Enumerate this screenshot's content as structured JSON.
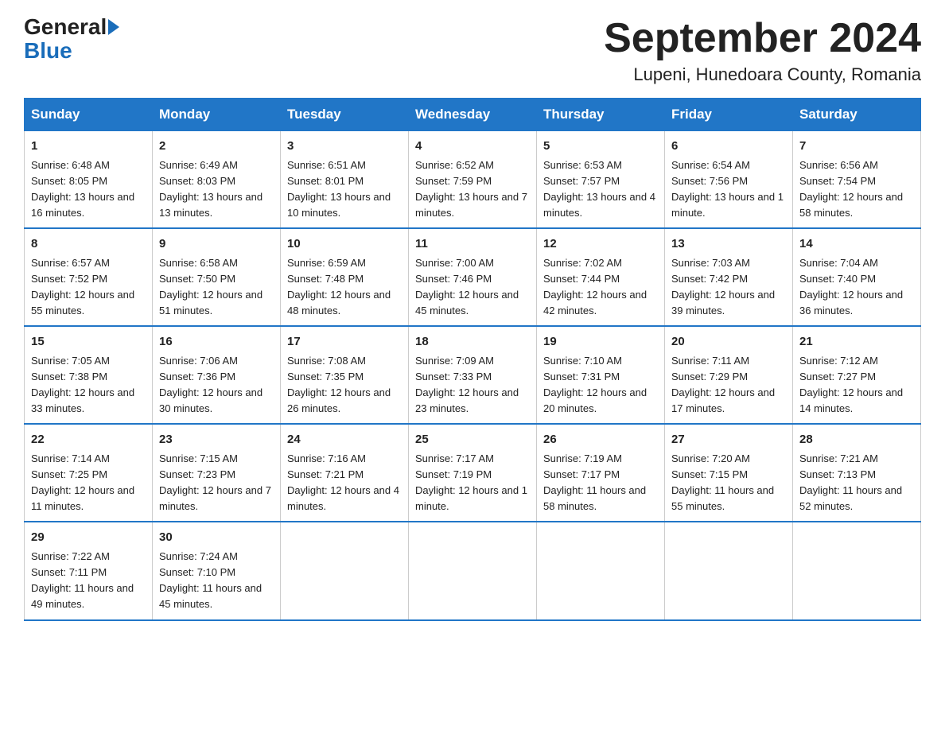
{
  "header": {
    "logo_general": "General",
    "logo_blue": "Blue",
    "month_title": "September 2024",
    "location": "Lupeni, Hunedoara County, Romania"
  },
  "days_of_week": [
    "Sunday",
    "Monday",
    "Tuesday",
    "Wednesday",
    "Thursday",
    "Friday",
    "Saturday"
  ],
  "weeks": [
    [
      {
        "day": "1",
        "sunrise": "Sunrise: 6:48 AM",
        "sunset": "Sunset: 8:05 PM",
        "daylight": "Daylight: 13 hours and 16 minutes."
      },
      {
        "day": "2",
        "sunrise": "Sunrise: 6:49 AM",
        "sunset": "Sunset: 8:03 PM",
        "daylight": "Daylight: 13 hours and 13 minutes."
      },
      {
        "day": "3",
        "sunrise": "Sunrise: 6:51 AM",
        "sunset": "Sunset: 8:01 PM",
        "daylight": "Daylight: 13 hours and 10 minutes."
      },
      {
        "day": "4",
        "sunrise": "Sunrise: 6:52 AM",
        "sunset": "Sunset: 7:59 PM",
        "daylight": "Daylight: 13 hours and 7 minutes."
      },
      {
        "day": "5",
        "sunrise": "Sunrise: 6:53 AM",
        "sunset": "Sunset: 7:57 PM",
        "daylight": "Daylight: 13 hours and 4 minutes."
      },
      {
        "day": "6",
        "sunrise": "Sunrise: 6:54 AM",
        "sunset": "Sunset: 7:56 PM",
        "daylight": "Daylight: 13 hours and 1 minute."
      },
      {
        "day": "7",
        "sunrise": "Sunrise: 6:56 AM",
        "sunset": "Sunset: 7:54 PM",
        "daylight": "Daylight: 12 hours and 58 minutes."
      }
    ],
    [
      {
        "day": "8",
        "sunrise": "Sunrise: 6:57 AM",
        "sunset": "Sunset: 7:52 PM",
        "daylight": "Daylight: 12 hours and 55 minutes."
      },
      {
        "day": "9",
        "sunrise": "Sunrise: 6:58 AM",
        "sunset": "Sunset: 7:50 PM",
        "daylight": "Daylight: 12 hours and 51 minutes."
      },
      {
        "day": "10",
        "sunrise": "Sunrise: 6:59 AM",
        "sunset": "Sunset: 7:48 PM",
        "daylight": "Daylight: 12 hours and 48 minutes."
      },
      {
        "day": "11",
        "sunrise": "Sunrise: 7:00 AM",
        "sunset": "Sunset: 7:46 PM",
        "daylight": "Daylight: 12 hours and 45 minutes."
      },
      {
        "day": "12",
        "sunrise": "Sunrise: 7:02 AM",
        "sunset": "Sunset: 7:44 PM",
        "daylight": "Daylight: 12 hours and 42 minutes."
      },
      {
        "day": "13",
        "sunrise": "Sunrise: 7:03 AM",
        "sunset": "Sunset: 7:42 PM",
        "daylight": "Daylight: 12 hours and 39 minutes."
      },
      {
        "day": "14",
        "sunrise": "Sunrise: 7:04 AM",
        "sunset": "Sunset: 7:40 PM",
        "daylight": "Daylight: 12 hours and 36 minutes."
      }
    ],
    [
      {
        "day": "15",
        "sunrise": "Sunrise: 7:05 AM",
        "sunset": "Sunset: 7:38 PM",
        "daylight": "Daylight: 12 hours and 33 minutes."
      },
      {
        "day": "16",
        "sunrise": "Sunrise: 7:06 AM",
        "sunset": "Sunset: 7:36 PM",
        "daylight": "Daylight: 12 hours and 30 minutes."
      },
      {
        "day": "17",
        "sunrise": "Sunrise: 7:08 AM",
        "sunset": "Sunset: 7:35 PM",
        "daylight": "Daylight: 12 hours and 26 minutes."
      },
      {
        "day": "18",
        "sunrise": "Sunrise: 7:09 AM",
        "sunset": "Sunset: 7:33 PM",
        "daylight": "Daylight: 12 hours and 23 minutes."
      },
      {
        "day": "19",
        "sunrise": "Sunrise: 7:10 AM",
        "sunset": "Sunset: 7:31 PM",
        "daylight": "Daylight: 12 hours and 20 minutes."
      },
      {
        "day": "20",
        "sunrise": "Sunrise: 7:11 AM",
        "sunset": "Sunset: 7:29 PM",
        "daylight": "Daylight: 12 hours and 17 minutes."
      },
      {
        "day": "21",
        "sunrise": "Sunrise: 7:12 AM",
        "sunset": "Sunset: 7:27 PM",
        "daylight": "Daylight: 12 hours and 14 minutes."
      }
    ],
    [
      {
        "day": "22",
        "sunrise": "Sunrise: 7:14 AM",
        "sunset": "Sunset: 7:25 PM",
        "daylight": "Daylight: 12 hours and 11 minutes."
      },
      {
        "day": "23",
        "sunrise": "Sunrise: 7:15 AM",
        "sunset": "Sunset: 7:23 PM",
        "daylight": "Daylight: 12 hours and 7 minutes."
      },
      {
        "day": "24",
        "sunrise": "Sunrise: 7:16 AM",
        "sunset": "Sunset: 7:21 PM",
        "daylight": "Daylight: 12 hours and 4 minutes."
      },
      {
        "day": "25",
        "sunrise": "Sunrise: 7:17 AM",
        "sunset": "Sunset: 7:19 PM",
        "daylight": "Daylight: 12 hours and 1 minute."
      },
      {
        "day": "26",
        "sunrise": "Sunrise: 7:19 AM",
        "sunset": "Sunset: 7:17 PM",
        "daylight": "Daylight: 11 hours and 58 minutes."
      },
      {
        "day": "27",
        "sunrise": "Sunrise: 7:20 AM",
        "sunset": "Sunset: 7:15 PM",
        "daylight": "Daylight: 11 hours and 55 minutes."
      },
      {
        "day": "28",
        "sunrise": "Sunrise: 7:21 AM",
        "sunset": "Sunset: 7:13 PM",
        "daylight": "Daylight: 11 hours and 52 minutes."
      }
    ],
    [
      {
        "day": "29",
        "sunrise": "Sunrise: 7:22 AM",
        "sunset": "Sunset: 7:11 PM",
        "daylight": "Daylight: 11 hours and 49 minutes."
      },
      {
        "day": "30",
        "sunrise": "Sunrise: 7:24 AM",
        "sunset": "Sunset: 7:10 PM",
        "daylight": "Daylight: 11 hours and 45 minutes."
      },
      null,
      null,
      null,
      null,
      null
    ]
  ]
}
